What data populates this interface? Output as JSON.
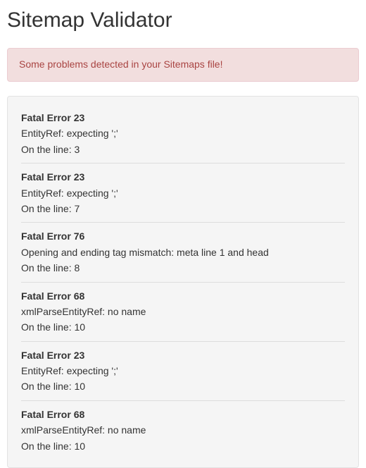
{
  "title": "Sitemap Validator",
  "alert": {
    "message": "Some problems detected in your Sitemaps file!"
  },
  "line_prefix": "On the line: ",
  "errors": [
    {
      "title": "Fatal Error 23",
      "message": "EntityRef: expecting ';'",
      "line": "3"
    },
    {
      "title": "Fatal Error 23",
      "message": "EntityRef: expecting ';'",
      "line": "7"
    },
    {
      "title": "Fatal Error 76",
      "message": "Opening and ending tag mismatch: meta line 1 and head",
      "line": "8"
    },
    {
      "title": "Fatal Error 68",
      "message": "xmlParseEntityRef: no name",
      "line": "10"
    },
    {
      "title": "Fatal Error 23",
      "message": "EntityRef: expecting ';'",
      "line": "10"
    },
    {
      "title": "Fatal Error 68",
      "message": "xmlParseEntityRef: no name",
      "line": "10"
    }
  ]
}
